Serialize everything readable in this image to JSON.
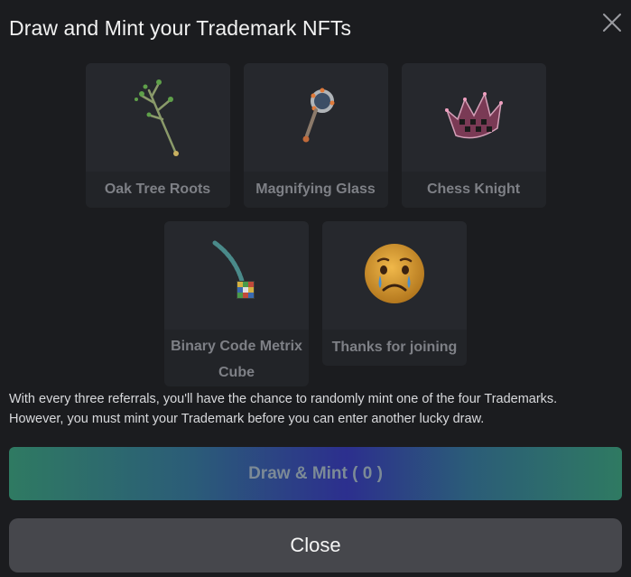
{
  "modal": {
    "title": "Draw and Mint your Trademark NFTs",
    "close_icon": "close-icon"
  },
  "cards_row1": [
    {
      "label": "Oak Tree Roots",
      "icon": "oak-tree-roots-image"
    },
    {
      "label": "Magnifying Glass",
      "icon": "magnifying-glass-image"
    },
    {
      "label": "Chess Knight",
      "icon": "chess-crown-image"
    }
  ],
  "cards_row2": [
    {
      "label": "Binary Code Metrix Cube",
      "icon": "rubiks-cube-wand-image"
    },
    {
      "label": "Thanks for joining",
      "icon": "sad-face-emoji"
    }
  ],
  "description": {
    "line1": "With every three referrals, you'll have the chance to randomly mint one of the four Trademarks.",
    "line2": "However, you must mint your Trademark before you can enter another lucky draw."
  },
  "buttons": {
    "draw_mint": "Draw & Mint ( 0 )",
    "close": "Close"
  },
  "colors": {
    "background": "#1b1c1f",
    "card": "#25272b",
    "close_button": "#46474c",
    "draw_gradient_start": "#2f7a62",
    "draw_gradient_mid": "#2c2f8e"
  }
}
